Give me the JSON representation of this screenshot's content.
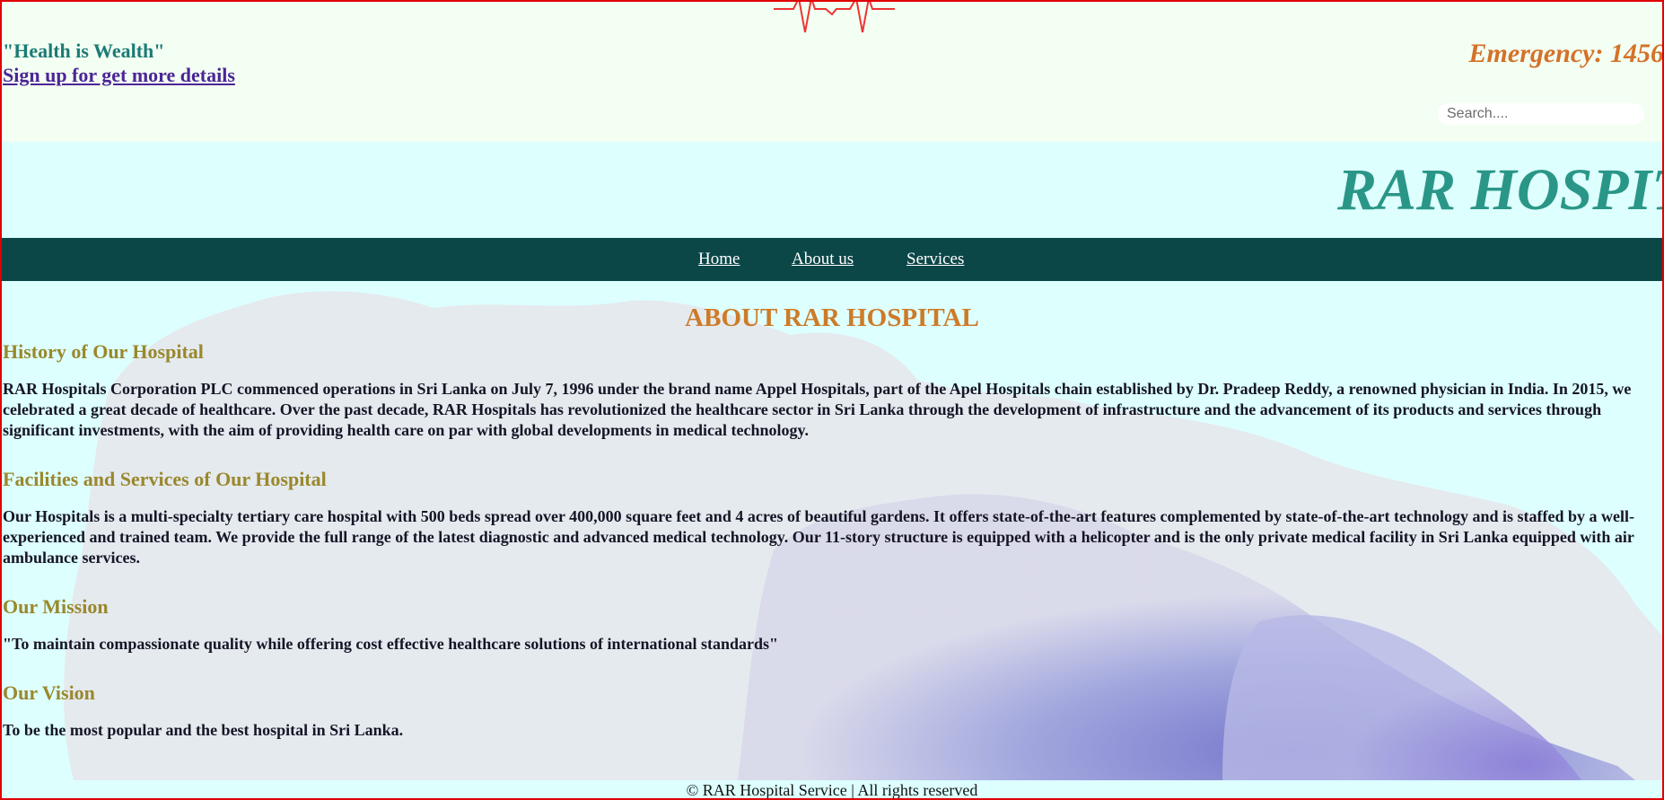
{
  "header": {
    "slogan": "\"Health is Wealth\"",
    "signup_link": "Sign up for get more details",
    "emergency": "Emergency: 1456",
    "search_placeholder": "Search....",
    "brand": "RAR HOSPITAL"
  },
  "nav": {
    "items": [
      "Home",
      "About us",
      "Services"
    ]
  },
  "main": {
    "title": "ABOUT RAR HOSPITAL",
    "sections": [
      {
        "heading": "History of Our Hospital",
        "text": "RAR Hospitals Corporation PLC commenced operations in Sri Lanka on July 7, 1996 under the brand name Appel Hospitals, part of the Apel Hospitals chain established by Dr. Pradeep Reddy, a renowned physician in India. In 2015, we celebrated a great decade of healthcare. Over the past decade, RAR Hospitals has revolutionized the healthcare sector in Sri Lanka through the development of infrastructure and the advancement of its products and services through significant investments, with the aim of providing health care on par with global developments in medical technology."
      },
      {
        "heading": "Facilities and Services of Our Hospital",
        "text": "Our Hospitals is a multi-specialty tertiary care hospital with 500 beds spread over 400,000 square feet and 4 acres of beautiful gardens. It offers state-of-the-art features complemented by state-of-the-art technology and is staffed by a well-experienced and trained team. We provide the full range of the latest diagnostic and advanced medical technology. Our 11-story structure is equipped with a helicopter and is the only private medical facility in Sri Lanka equipped with air ambulance services."
      },
      {
        "heading": "Our Mission",
        "text": "\"To maintain compassionate quality while offering cost effective healthcare solutions of international standards\""
      },
      {
        "heading": "Our Vision",
        "text": "To be the most popular and the best hospital in Sri Lanka."
      }
    ]
  },
  "footer": {
    "text": "© RAR Hospital Service | All rights reserved"
  },
  "colors": {
    "frame_border": "#e00000",
    "topbar_bg": "#f3fff2",
    "page_bg": "#ddfffe",
    "nav_bg": "#0c4748",
    "slogan": "#1b7b76",
    "emergency": "#d47229",
    "brand": "#2a9688",
    "section_heading": "#99882c",
    "title": "#cd7b28"
  },
  "icons": {
    "heartbeat": "heartbeat-line-icon"
  }
}
